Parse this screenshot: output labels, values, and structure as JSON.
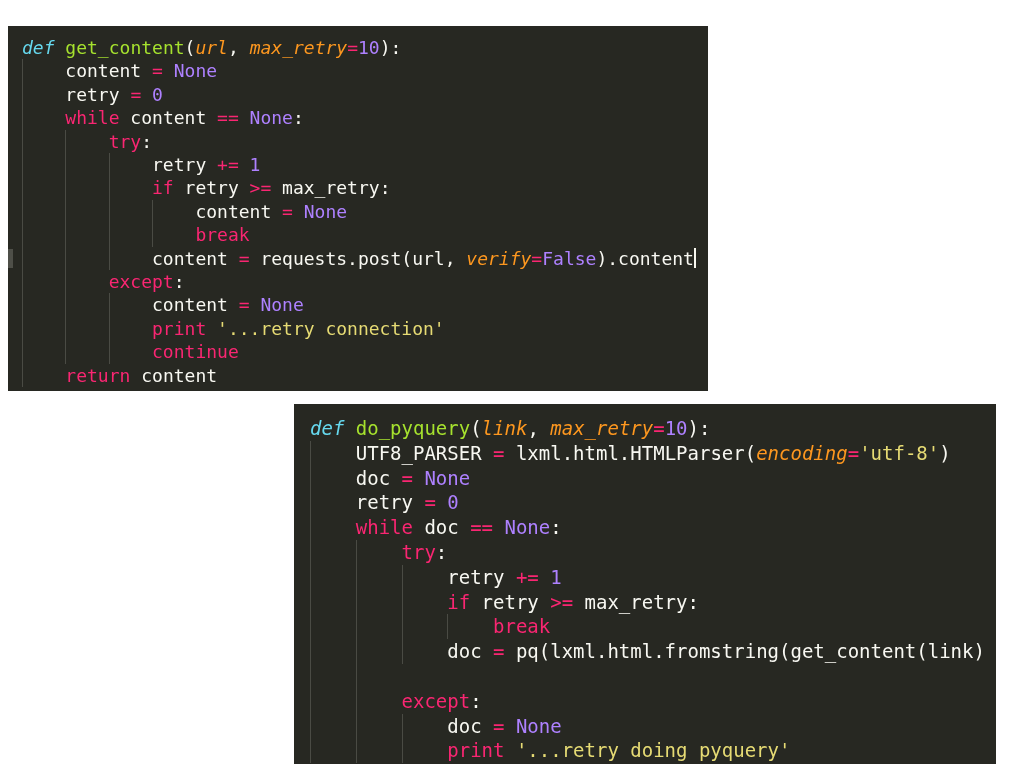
{
  "editors": [
    {
      "lines": [
        {
          "tokens": [
            {
              "kind": "def",
              "text": "def "
            },
            {
              "kind": "func",
              "text": "get_content"
            },
            {
              "kind": "plain",
              "text": "("
            },
            {
              "kind": "param",
              "text": "url"
            },
            {
              "kind": "plain",
              "text": ", "
            },
            {
              "kind": "param",
              "text": "max_retry"
            },
            {
              "kind": "op",
              "text": "="
            },
            {
              "kind": "const",
              "text": "10"
            },
            {
              "kind": "plain",
              "text": "):"
            }
          ],
          "children": [
            {
              "tokens": [
                {
                  "kind": "plain",
                  "text": "content "
                },
                {
                  "kind": "op",
                  "text": "= "
                },
                {
                  "kind": "const",
                  "text": "None"
                }
              ]
            },
            {
              "tokens": [
                {
                  "kind": "plain",
                  "text": "retry "
                },
                {
                  "kind": "op",
                  "text": "= "
                },
                {
                  "kind": "const",
                  "text": "0"
                }
              ]
            },
            {
              "tokens": [
                {
                  "kind": "keyword",
                  "text": "while"
                },
                {
                  "kind": "plain",
                  "text": " content "
                },
                {
                  "kind": "op",
                  "text": "== "
                },
                {
                  "kind": "const",
                  "text": "None"
                },
                {
                  "kind": "plain",
                  "text": ":"
                }
              ],
              "children": [
                {
                  "tokens": [
                    {
                      "kind": "keyword",
                      "text": "try"
                    },
                    {
                      "kind": "plain",
                      "text": ":"
                    }
                  ],
                  "children": [
                    {
                      "tokens": [
                        {
                          "kind": "plain",
                          "text": "retry "
                        },
                        {
                          "kind": "op",
                          "text": "+= "
                        },
                        {
                          "kind": "const",
                          "text": "1"
                        }
                      ]
                    },
                    {
                      "tokens": [
                        {
                          "kind": "keyword",
                          "text": "if"
                        },
                        {
                          "kind": "plain",
                          "text": " retry "
                        },
                        {
                          "kind": "op",
                          "text": ">="
                        },
                        {
                          "kind": "plain",
                          "text": " max_retry:"
                        }
                      ],
                      "children": [
                        {
                          "tokens": [
                            {
                              "kind": "plain",
                              "text": "content "
                            },
                            {
                              "kind": "op",
                              "text": "= "
                            },
                            {
                              "kind": "const",
                              "text": "None"
                            }
                          ]
                        },
                        {
                          "tokens": [
                            {
                              "kind": "keyword",
                              "text": "break"
                            }
                          ]
                        }
                      ]
                    },
                    {
                      "tokens": [
                        {
                          "kind": "plain",
                          "text": "content "
                        },
                        {
                          "kind": "op",
                          "text": "="
                        },
                        {
                          "kind": "plain",
                          "text": " requests.post(url, "
                        },
                        {
                          "kind": "param",
                          "text": "verify"
                        },
                        {
                          "kind": "op",
                          "text": "="
                        },
                        {
                          "kind": "const",
                          "text": "False"
                        },
                        {
                          "kind": "plain",
                          "text": ").content"
                        }
                      ],
                      "current": true
                    }
                  ]
                },
                {
                  "tokens": [
                    {
                      "kind": "keyword",
                      "text": "except"
                    },
                    {
                      "kind": "plain",
                      "text": ":"
                    }
                  ],
                  "children": [
                    {
                      "tokens": [
                        {
                          "kind": "plain",
                          "text": "content "
                        },
                        {
                          "kind": "op",
                          "text": "= "
                        },
                        {
                          "kind": "const",
                          "text": "None"
                        }
                      ]
                    },
                    {
                      "tokens": [
                        {
                          "kind": "keyword",
                          "text": "print "
                        },
                        {
                          "kind": "string",
                          "text": "'...retry connection'"
                        }
                      ]
                    },
                    {
                      "tokens": [
                        {
                          "kind": "keyword",
                          "text": "continue"
                        }
                      ]
                    }
                  ]
                }
              ]
            },
            {
              "tokens": [
                {
                  "kind": "keyword",
                  "text": "return"
                },
                {
                  "kind": "plain",
                  "text": " content"
                }
              ]
            }
          ]
        }
      ]
    },
    {
      "lines": [
        {
          "tokens": [
            {
              "kind": "def",
              "text": "def "
            },
            {
              "kind": "func",
              "text": "do_pyquery"
            },
            {
              "kind": "plain",
              "text": "("
            },
            {
              "kind": "param",
              "text": "link"
            },
            {
              "kind": "plain",
              "text": ", "
            },
            {
              "kind": "param",
              "text": "max_retry"
            },
            {
              "kind": "op",
              "text": "="
            },
            {
              "kind": "const",
              "text": "10"
            },
            {
              "kind": "plain",
              "text": "):"
            }
          ],
          "children": [
            {
              "tokens": [
                {
                  "kind": "plain",
                  "text": "UTF8_PARSER "
                },
                {
                  "kind": "op",
                  "text": "="
                },
                {
                  "kind": "plain",
                  "text": " lxml.html.HTMLParser("
                },
                {
                  "kind": "param",
                  "text": "encoding"
                },
                {
                  "kind": "op",
                  "text": "="
                },
                {
                  "kind": "string",
                  "text": "'utf-8'"
                },
                {
                  "kind": "plain",
                  "text": ")"
                }
              ]
            },
            {
              "tokens": [
                {
                  "kind": "plain",
                  "text": "doc "
                },
                {
                  "kind": "op",
                  "text": "= "
                },
                {
                  "kind": "const",
                  "text": "None"
                }
              ]
            },
            {
              "tokens": [
                {
                  "kind": "plain",
                  "text": "retry "
                },
                {
                  "kind": "op",
                  "text": "= "
                },
                {
                  "kind": "const",
                  "text": "0"
                }
              ]
            },
            {
              "tokens": [
                {
                  "kind": "keyword",
                  "text": "while"
                },
                {
                  "kind": "plain",
                  "text": " doc "
                },
                {
                  "kind": "op",
                  "text": "== "
                },
                {
                  "kind": "const",
                  "text": "None"
                },
                {
                  "kind": "plain",
                  "text": ":"
                }
              ],
              "children": [
                {
                  "tokens": [
                    {
                      "kind": "keyword",
                      "text": "try"
                    },
                    {
                      "kind": "plain",
                      "text": ":"
                    }
                  ],
                  "children": [
                    {
                      "tokens": [
                        {
                          "kind": "plain",
                          "text": "retry "
                        },
                        {
                          "kind": "op",
                          "text": "+= "
                        },
                        {
                          "kind": "const",
                          "text": "1"
                        }
                      ]
                    },
                    {
                      "tokens": [
                        {
                          "kind": "keyword",
                          "text": "if"
                        },
                        {
                          "kind": "plain",
                          "text": " retry "
                        },
                        {
                          "kind": "op",
                          "text": ">="
                        },
                        {
                          "kind": "plain",
                          "text": " max_retry:"
                        }
                      ],
                      "children": [
                        {
                          "tokens": [
                            {
                              "kind": "keyword",
                              "text": "break"
                            }
                          ]
                        }
                      ]
                    },
                    {
                      "tokens": [
                        {
                          "kind": "plain",
                          "text": "doc "
                        },
                        {
                          "kind": "op",
                          "text": "="
                        },
                        {
                          "kind": "plain",
                          "text": " pq(lxml.html.fromstring(get_content(link)"
                        }
                      ],
                      "gap_after": true
                    }
                  ]
                },
                {
                  "tokens": [
                    {
                      "kind": "keyword",
                      "text": "except"
                    },
                    {
                      "kind": "plain",
                      "text": ":"
                    }
                  ],
                  "children": [
                    {
                      "tokens": [
                        {
                          "kind": "plain",
                          "text": "doc "
                        },
                        {
                          "kind": "op",
                          "text": "= "
                        },
                        {
                          "kind": "const",
                          "text": "None"
                        }
                      ]
                    },
                    {
                      "tokens": [
                        {
                          "kind": "keyword",
                          "text": "print "
                        },
                        {
                          "kind": "string",
                          "text": "'...retry doing pyquery'"
                        }
                      ]
                    }
                  ]
                }
              ]
            }
          ]
        }
      ]
    }
  ]
}
